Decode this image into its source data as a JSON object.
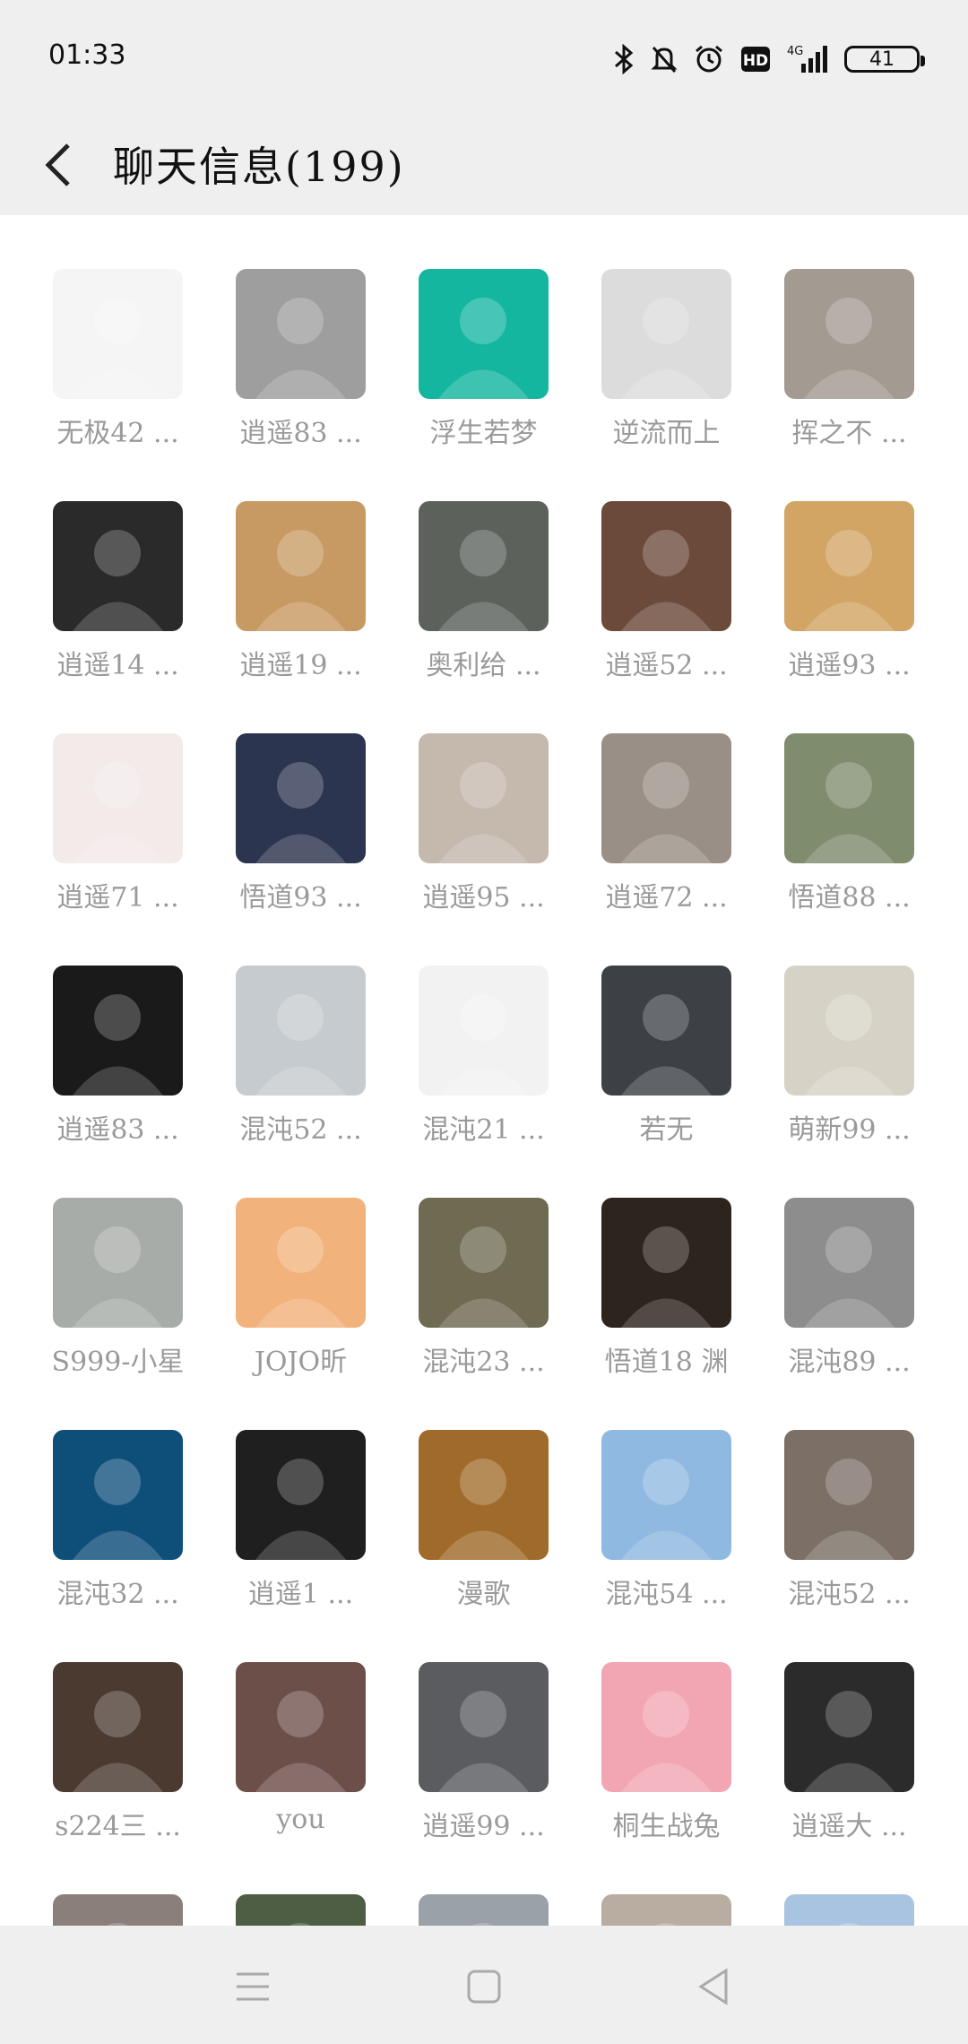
{
  "status_bar": {
    "time": "01:33",
    "icons": [
      "bluetooth-icon",
      "mute-bell-icon",
      "alarm-icon",
      "hd-icon",
      "signal-4g-icon"
    ],
    "network": "4G",
    "hd": "HD",
    "battery": "41"
  },
  "header": {
    "back_icon": "chevron-left-icon",
    "title": "聊天信息(199)"
  },
  "members": [
    {
      "name": "无极42 ...",
      "bg": "#f5f5f5"
    },
    {
      "name": "逍遥83 ...",
      "bg": "#9e9e9e"
    },
    {
      "name": "浮生若梦",
      "bg": "#15b6a0"
    },
    {
      "name": "逆流而上",
      "bg": "#dcdcdc"
    },
    {
      "name": "挥之不 ...",
      "bg": "#a39a92"
    },
    {
      "name": "逍遥14 ...",
      "bg": "#2a2a2a"
    },
    {
      "name": "逍遥19 ...",
      "bg": "#c89a63"
    },
    {
      "name": "奥利给 ...",
      "bg": "#5c615c"
    },
    {
      "name": "逍遥52 ...",
      "bg": "#6b4a3a"
    },
    {
      "name": "逍遥93 ...",
      "bg": "#d2a565"
    },
    {
      "name": "逍遥71 ...",
      "bg": "#f3eaea"
    },
    {
      "name": "悟道93 ...",
      "bg": "#2c3550"
    },
    {
      "name": "逍遥95 ...",
      "bg": "#c5b8ad"
    },
    {
      "name": "逍遥72 ...",
      "bg": "#9a8f86"
    },
    {
      "name": "悟道88 ...",
      "bg": "#7f8c6e"
    },
    {
      "name": "逍遥83 ...",
      "bg": "#1a1a1a"
    },
    {
      "name": "混沌52 ...",
      "bg": "#c6cbcf"
    },
    {
      "name": "混沌21 ...",
      "bg": "#f2f2f2"
    },
    {
      "name": "若无",
      "bg": "#3d4146"
    },
    {
      "name": "萌新99 ...",
      "bg": "#d7d2c6"
    },
    {
      "name": "S999-小星",
      "bg": "#a8aca8"
    },
    {
      "name": "JOJO昕",
      "bg": "#f2b27c"
    },
    {
      "name": "混沌23 ...",
      "bg": "#6f6a52"
    },
    {
      "name": "悟道18 渊",
      "bg": "#2d241d"
    },
    {
      "name": "混沌89 ...",
      "bg": "#8d8d8d"
    },
    {
      "name": "混沌32 ...",
      "bg": "#0e4f7a"
    },
    {
      "name": "逍遥1 ...",
      "bg": "#1f1f1f"
    },
    {
      "name": "漫歌",
      "bg": "#a06b2a"
    },
    {
      "name": "混沌54 ...",
      "bg": "#8fb9e0"
    },
    {
      "name": "混沌52 ...",
      "bg": "#7b6f66"
    },
    {
      "name": "s224三 ...",
      "bg": "#4a3a30"
    },
    {
      "name": "you",
      "bg": "#6d4f4a"
    },
    {
      "name": "逍遥99 ...",
      "bg": "#5a5c60"
    },
    {
      "name": "桐生战兔",
      "bg": "#f2a6b4"
    },
    {
      "name": "逍遥大 ...",
      "bg": "#2b2b2b"
    },
    {
      "name": "",
      "bg": "#8a7f7a"
    },
    {
      "name": "",
      "bg": "#4e5e44"
    },
    {
      "name": "",
      "bg": "#9aa1a8"
    },
    {
      "name": "",
      "bg": "#b9ada2"
    },
    {
      "name": "",
      "bg": "#a9c4e0"
    }
  ],
  "nav_bar": {
    "icons": [
      "menu-icon",
      "home-square-icon",
      "back-triangle-icon"
    ]
  }
}
